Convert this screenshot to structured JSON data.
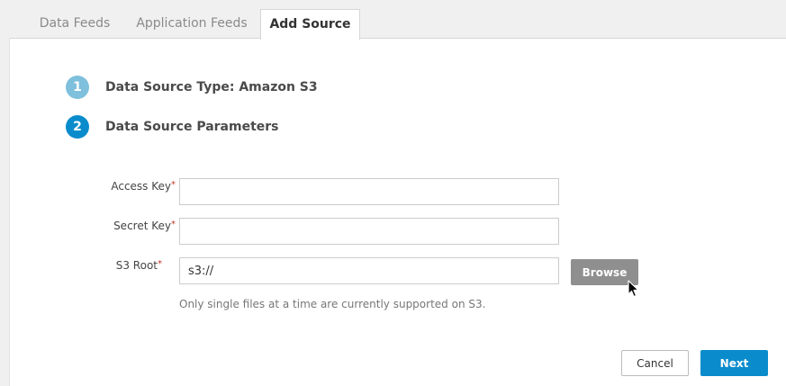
{
  "tabs": [
    {
      "label": "Data Feeds",
      "active": false
    },
    {
      "label": "Application Feeds",
      "active": false
    },
    {
      "label": "Add Source",
      "active": true
    }
  ],
  "steps": [
    {
      "number": "1",
      "title": "Data Source Type: Amazon S3",
      "state": "completed"
    },
    {
      "number": "2",
      "title": "Data Source Parameters",
      "state": "current"
    }
  ],
  "form": {
    "access_key": {
      "label": "Access Key",
      "required_mark": "*",
      "value": ""
    },
    "secret_key": {
      "label": "Secret Key",
      "required_mark": "*",
      "value": ""
    },
    "s3_root": {
      "label": "S3 Root",
      "required_mark": "*",
      "value": "s3://"
    },
    "browse_label": "Browse",
    "hint": "Only single files at a time are currently supported on S3."
  },
  "actions": {
    "cancel_label": "Cancel",
    "next_label": "Next"
  },
  "colors": {
    "accent": "#0a8ccc",
    "step_done": "#7fc0dc",
    "required": "#c0392b",
    "browse_bg": "#8f8f8f"
  },
  "icons": {
    "cursor": "mouse-pointer-icon"
  }
}
